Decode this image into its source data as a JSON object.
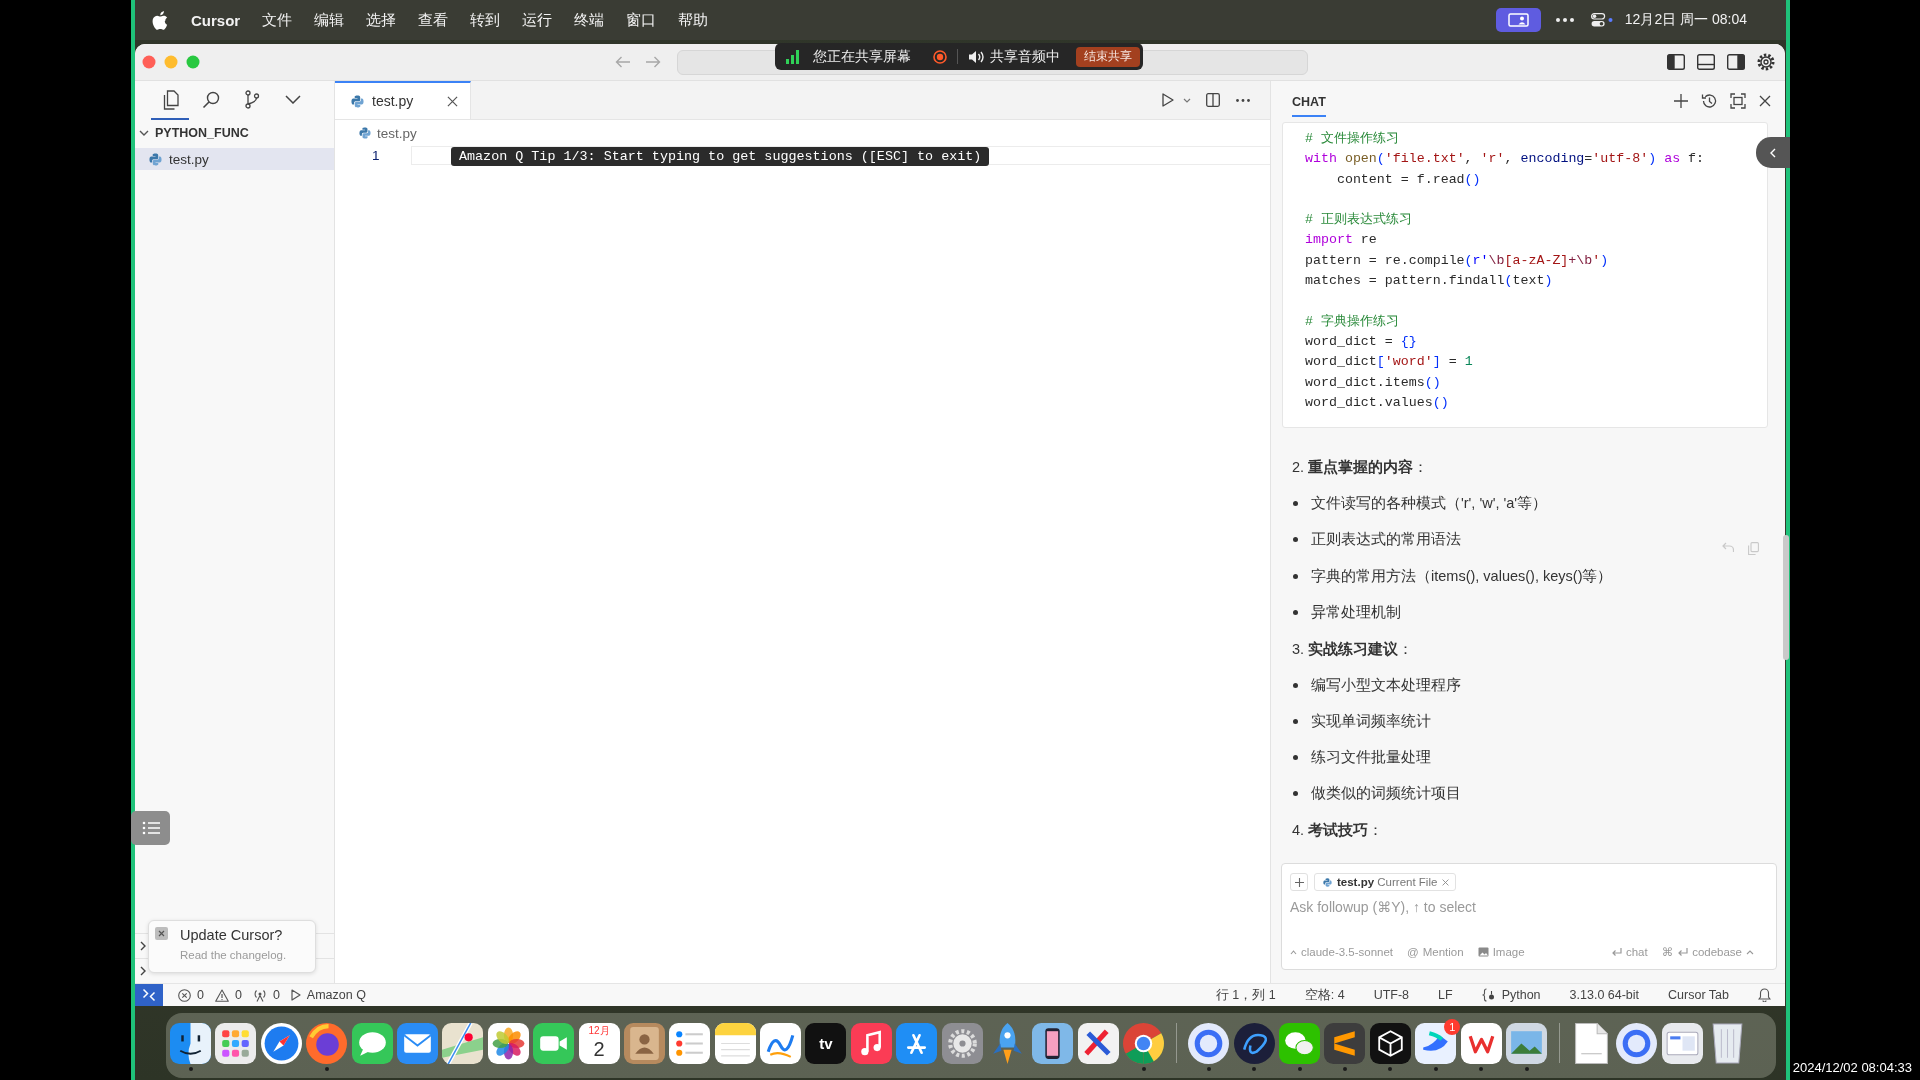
{
  "menu_bar": {
    "app_name": "Cursor",
    "menus": [
      "文件",
      "编辑",
      "选择",
      "查看",
      "转到",
      "运行",
      "终端",
      "窗口",
      "帮助"
    ],
    "clock": "12月2日 周一 08:04"
  },
  "title_bar": {
    "screen_share": {
      "status": "您正在共享屏幕",
      "audio": "共享音频中",
      "stop_button": "结束共享"
    }
  },
  "sidebar": {
    "toolbar": [
      {
        "kind": "files",
        "selected": true
      },
      {
        "kind": "search",
        "selected": false
      },
      {
        "kind": "branch",
        "selected": false
      },
      {
        "kind": "more",
        "selected": false
      }
    ],
    "tree": [
      {
        "label": "PYTHON_FUNC",
        "expanded": true,
        "selected": false,
        "children": [
          {
            "label": "test.py",
            "selected": true
          }
        ]
      }
    ],
    "collapsed_sections": [
      {
        "expanded": false
      },
      {
        "expanded": false
      }
    ]
  },
  "notification": {
    "title": "Update Cursor?",
    "body": "Read the changelog."
  },
  "editor": {
    "tabs": [
      {
        "label": "test.py",
        "selected": true
      }
    ],
    "breadcrumb": "test.py",
    "line_numbers": [
      "1"
    ],
    "tip": "Amazon Q Tip 1/3: Start typing to get suggestions ([ESC] to exit)"
  },
  "chat": {
    "tabs": [
      {
        "label": "CHAT",
        "selected": true
      }
    ],
    "code_block": {
      "sections": [
        {
          "lines": [
            [
              {
                "text": "# 文件操作练习",
                "kind": "comment"
              }
            ],
            [
              {
                "text": "with ",
                "kind": "keyword"
              },
              {
                "text": "open",
                "kind": "function"
              },
              {
                "text": "(",
                "kind": "bracket"
              },
              {
                "text": "'file.txt'",
                "kind": "string"
              },
              {
                "text": ", ",
                "kind": "plain"
              },
              {
                "text": "'r'",
                "kind": "string"
              },
              {
                "text": ", ",
                "kind": "plain"
              },
              {
                "text": "encoding",
                "kind": "parameter"
              },
              {
                "text": "=",
                "kind": "plain"
              },
              {
                "text": "'utf-8'",
                "kind": "string"
              },
              {
                "text": ")",
                "kind": "bracket"
              },
              {
                "text": " as",
                "kind": "keyword"
              },
              {
                "text": " f:",
                "kind": "plain"
              }
            ],
            [
              {
                "text": "    content = f.read",
                "kind": "plain"
              },
              {
                "text": "()",
                "kind": "bracket"
              }
            ]
          ]
        },
        {
          "lines": [
            [
              {
                "text": "# 正则表达式练习",
                "kind": "comment"
              }
            ],
            [
              {
                "text": "import",
                "kind": "keyword"
              },
              {
                "text": " re",
                "kind": "plain"
              }
            ],
            [
              {
                "text": "pattern = re.compile",
                "kind": "plain"
              },
              {
                "text": "(",
                "kind": "bracket"
              },
              {
                "text": "r'",
                "kind": "prefix"
              },
              {
                "text": "\\b",
                "kind": "regex"
              },
              {
                "text": "[a-zA-Z]",
                "kind": "string"
              },
              {
                "text": "+\\b",
                "kind": "regex"
              },
              {
                "text": "'",
                "kind": "string"
              },
              {
                "text": ")",
                "kind": "bracket"
              }
            ],
            [
              {
                "text": "matches = pattern.findall",
                "kind": "plain"
              },
              {
                "text": "(",
                "kind": "bracket"
              },
              {
                "text": "text",
                "kind": "plain"
              },
              {
                "text": ")",
                "kind": "bracket"
              }
            ]
          ]
        },
        {
          "lines": [
            [
              {
                "text": "# 字典操作练习",
                "kind": "comment"
              }
            ],
            [
              {
                "text": "word_dict = ",
                "kind": "plain"
              },
              {
                "text": "{}",
                "kind": "bracket"
              }
            ],
            [
              {
                "text": "word_dict",
                "kind": "plain"
              },
              {
                "text": "[",
                "kind": "bracket"
              },
              {
                "text": "'word'",
                "kind": "string"
              },
              {
                "text": "]",
                "kind": "bracket"
              },
              {
                "text": " = ",
                "kind": "plain"
              },
              {
                "text": "1",
                "kind": "number"
              }
            ],
            [
              {
                "text": "word_dict.items",
                "kind": "plain"
              },
              {
                "text": "()",
                "kind": "bracket"
              }
            ],
            [
              {
                "text": "word_dict.values",
                "kind": "plain"
              },
              {
                "text": "()",
                "kind": "bracket"
              }
            ]
          ]
        }
      ]
    },
    "sections": [
      {
        "heading": "2. **重点掌握的内容**：",
        "items": [
          "文件读写的各种模式（'r', 'w', 'a'等）",
          "正则表达式的常用语法",
          "字典的常用方法（items(), values(), keys()等）",
          "异常处理机制"
        ]
      },
      {
        "heading": "3. **实战练习建议**：",
        "items": [
          "编写小型文本处理程序",
          "实现单词频率统计",
          "练习文件批量处理",
          "做类似的词频统计项目"
        ]
      },
      {
        "heading": "4. **考试技巧**："
      }
    ],
    "composer": {
      "context_chip": {
        "file": "test.py",
        "note": "Current File"
      },
      "placeholder": "Ask followup (⌘Y), ↑ to select",
      "options": [
        {
          "kind": "model",
          "label": "claude-3.5-sonnet"
        },
        {
          "kind": "mention",
          "symbol": "@",
          "label": "Mention"
        },
        {
          "kind": "image",
          "label": "Image"
        }
      ],
      "submit": [
        {
          "kind": "enter",
          "label": "chat"
        },
        {
          "kind": "command_enter",
          "symbol": "⌘",
          "label": "codebase"
        }
      ]
    }
  },
  "status_bar": {
    "left": [
      {
        "kind": "errors",
        "text": "0"
      },
      {
        "kind": "warnings",
        "text": "0"
      },
      {
        "kind": "ports",
        "text": "0"
      },
      {
        "kind": "run",
        "text": "Amazon Q"
      }
    ],
    "right": [
      {
        "kind": "plain",
        "text": "行 1，列 1"
      },
      {
        "kind": "plain",
        "text": "空格: 4"
      },
      {
        "kind": "plain",
        "text": "UTF-8"
      },
      {
        "kind": "plain",
        "text": "LF"
      },
      {
        "kind": "language",
        "text": "Python"
      },
      {
        "kind": "plain",
        "text": "3.13.0 64-bit"
      },
      {
        "kind": "plain",
        "text": "Cursor Tab"
      }
    ]
  },
  "dock": [
    {
      "kind": "finder",
      "running": true
    },
    {
      "kind": "launchpad",
      "running": false
    },
    {
      "kind": "safari",
      "running": false
    },
    {
      "kind": "firefox",
      "running": true
    },
    {
      "kind": "messages",
      "running": false
    },
    {
      "kind": "mail",
      "running": false
    },
    {
      "kind": "maps",
      "running": false
    },
    {
      "kind": "photos",
      "running": false
    },
    {
      "kind": "facetime",
      "running": false
    },
    {
      "kind": "calendar",
      "running": false,
      "month": "12月",
      "day": "2"
    },
    {
      "kind": "contacts",
      "running": false
    },
    {
      "kind": "reminders",
      "running": false
    },
    {
      "kind": "notes",
      "running": false
    },
    {
      "kind": "freeform",
      "running": false
    },
    {
      "kind": "tv",
      "running": false,
      "label": "tv"
    },
    {
      "kind": "music",
      "running": false
    },
    {
      "kind": "appstore",
      "running": false
    },
    {
      "kind": "settings",
      "running": false
    },
    {
      "kind": "rocket",
      "running": false
    },
    {
      "kind": "phone",
      "running": false
    },
    {
      "kind": "crossed",
      "running": false
    },
    {
      "kind": "chrome",
      "running": true
    },
    {
      "kind": "separator"
    },
    {
      "kind": "ring",
      "running": true
    },
    {
      "kind": "swirl",
      "running": true
    },
    {
      "kind": "wechat",
      "running": true
    },
    {
      "kind": "stripes",
      "running": true
    },
    {
      "kind": "cube",
      "running": true
    },
    {
      "kind": "lark",
      "running": true,
      "badge": "1"
    },
    {
      "kind": "wps",
      "running": true
    },
    {
      "kind": "preview",
      "running": true
    },
    {
      "kind": "separator"
    },
    {
      "kind": "document",
      "running": false
    },
    {
      "kind": "ring",
      "running": false
    },
    {
      "kind": "screenshot",
      "running": false
    },
    {
      "kind": "trash",
      "running": false
    }
  ],
  "recording_timestamp": "2024/12/02 08:04:33"
}
